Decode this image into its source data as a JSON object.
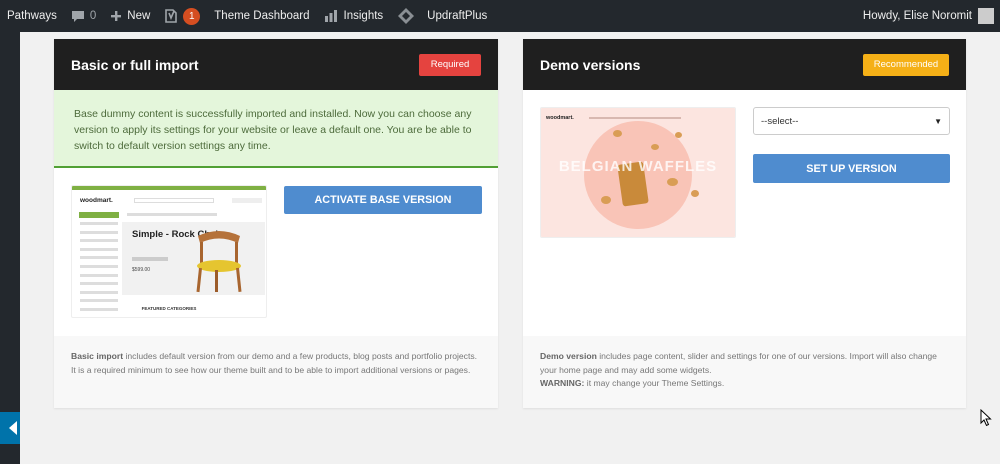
{
  "adminbar": {
    "site_name": "Pathways",
    "comments_count": "0",
    "new_label": "New",
    "yoast_badge": "1",
    "theme_dashboard": "Theme Dashboard",
    "insights": "Insights",
    "updraftplus": "UpdraftPlus",
    "howdy": "Howdy, Elise Noromit"
  },
  "basic_panel": {
    "title": "Basic or full import",
    "tag": "Required",
    "notice": "Base dummy content is successfully imported and installed. Now you can choose any version to apply its settings for your website or leave a default one. You are be able to switch to default version settings any time.",
    "button": "ACTIVATE BASE VERSION",
    "footer_bold": "Basic import",
    "footer_text": " includes default version from our demo and a few products, blog posts and portfolio projects. It is a required minimum to see how our theme built and to be able to import additional versions or pages.",
    "preview": {
      "logo": "woodmart.",
      "hero_title": "Simple - Rock Chair.",
      "price": "$599.00",
      "section": "FEATURED CATEGORIES"
    }
  },
  "demo_panel": {
    "title": "Demo versions",
    "tag": "Recommended",
    "select_value": "--select--",
    "button": "SET UP VERSION",
    "footer_bold": "Demo version",
    "footer_text": " includes page content, slider and settings for one of our versions. Import will also change your home page and may add some widgets.",
    "warning_bold": "WARNING:",
    "warning_text": " it may change your Theme Settings.",
    "preview": {
      "logo": "woodmart.",
      "hero_text": "BELGIAN WAFFLES"
    }
  },
  "colors": {
    "admin_bar": "#23282d",
    "required": "#e5433f",
    "recommended": "#f5b017",
    "button_blue": "#4f8ccf",
    "notice_bg": "#e4f6db",
    "notice_border": "#51a034"
  }
}
